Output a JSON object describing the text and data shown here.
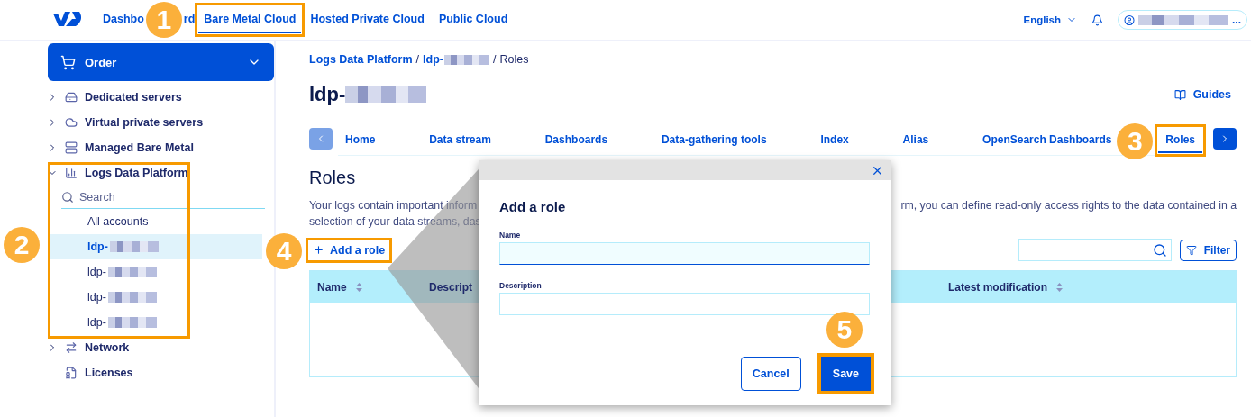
{
  "header": {
    "nav": [
      {
        "segments": [
          "Dashbo",
          "rd"
        ],
        "selected": false,
        "highlighted": false
      },
      {
        "segments": [
          "Bare Metal Cloud"
        ],
        "selected": true,
        "highlighted": true,
        "callout": "1"
      },
      {
        "segments": [
          "Hosted Private Cloud"
        ],
        "selected": false,
        "highlighted": false
      },
      {
        "segments": [
          "Public Cloud"
        ],
        "selected": false,
        "highlighted": false
      }
    ],
    "language": "English",
    "account": {
      "label": "..."
    }
  },
  "sidebar": {
    "order": "Order",
    "items": [
      {
        "label": "Dedicated servers",
        "expandable": true,
        "expanded": false,
        "highlighted": false
      },
      {
        "label": "Virtual private servers",
        "expandable": true,
        "expanded": false,
        "highlighted": false
      },
      {
        "label": "Managed Bare Metal",
        "expandable": true,
        "expanded": false,
        "highlighted": false
      },
      {
        "label": "Logs Data Platform",
        "expandable": true,
        "expanded": true,
        "highlighted": true,
        "callout": "2",
        "search_placeholder": "Search",
        "children": [
          {
            "label": "All accounts",
            "redacted": false,
            "selected": false
          },
          {
            "label": "ldp-",
            "redacted": true,
            "selected": true
          },
          {
            "label": "ldp-",
            "redacted": true,
            "selected": false
          },
          {
            "label": "ldp-",
            "redacted": true,
            "selected": false
          },
          {
            "label": "ldp-",
            "redacted": true,
            "selected": false
          }
        ]
      },
      {
        "label": "Network",
        "expandable": true,
        "expanded": false,
        "highlighted": false
      },
      {
        "label": "Licenses",
        "expandable": false,
        "highlighted": false
      }
    ]
  },
  "main": {
    "breadcrumb": [
      {
        "label": "Logs Data Platform",
        "redacted": false,
        "link": true
      },
      {
        "label": "ldp-",
        "redacted": true,
        "link": true
      },
      {
        "label": "Roles",
        "redacted": false,
        "link": false
      }
    ],
    "separator": "/",
    "title": {
      "label": "ldp-",
      "redacted": true
    },
    "guides": "Guides",
    "tabs": [
      {
        "label": "Home",
        "selected": false,
        "highlighted": false
      },
      {
        "label": "Data stream",
        "selected": false,
        "highlighted": false
      },
      {
        "label": "Dashboards",
        "selected": false,
        "highlighted": false
      },
      {
        "label": "Data-gathering tools",
        "selected": false,
        "highlighted": false
      },
      {
        "label": "Index",
        "selected": false,
        "highlighted": false
      },
      {
        "label": "Alias",
        "selected": false,
        "highlighted": false
      },
      {
        "label": "OpenSearch Dashboards",
        "selected": false,
        "highlighted": false
      },
      {
        "label": "Roles",
        "selected": true,
        "highlighted": true,
        "callout": "3"
      }
    ],
    "heading": "Roles",
    "description": [
      {
        "segments": [
          "Your logs contain important inform",
          "rm, you can define read-only access rights to the data contained in a"
        ]
      },
      {
        "segments": [
          "selection of your data streams, das"
        ]
      }
    ],
    "add_button": {
      "label": "Add a role",
      "highlighted": true,
      "callout": "4"
    },
    "filter": "Filter",
    "table": {
      "columns": [
        {
          "label": "Name",
          "sortable": true
        },
        {
          "label": "Descript",
          "sortable": false
        },
        {
          "label": "Latest modification",
          "sortable": true
        }
      ]
    }
  },
  "modal": {
    "title": "Add a role",
    "fields": [
      {
        "label": "Name",
        "focused": true
      },
      {
        "label": "Description",
        "focused": false
      }
    ],
    "buttons": [
      {
        "label": "Cancel",
        "kind": "secondary",
        "highlighted": false
      },
      {
        "label": "Save",
        "kind": "primary",
        "highlighted": true,
        "callout": "5"
      }
    ]
  }
}
